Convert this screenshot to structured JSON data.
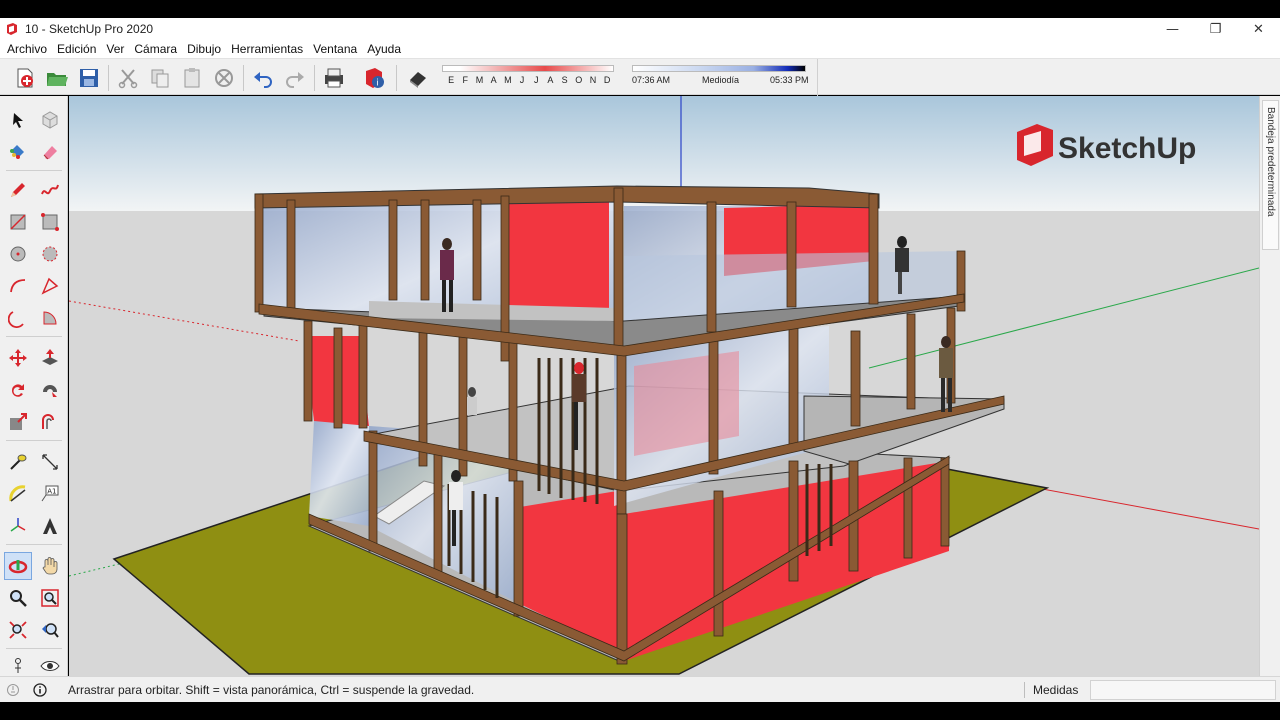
{
  "window": {
    "title": "10 - SketchUp Pro 2020",
    "controls": {
      "minimize": "—",
      "restore": "❐",
      "close": "✕"
    }
  },
  "menu": [
    "Archivo",
    "Edición",
    "Ver",
    "Cámara",
    "Dibujo",
    "Herramientas",
    "Ventana",
    "Ayuda"
  ],
  "toolbar": {
    "icons": [
      "new-file-icon",
      "open-folder-icon",
      "save-icon",
      "cut-icon",
      "copy-icon",
      "paste-icon",
      "erase-icon",
      "undo-icon",
      "redo-icon",
      "print-icon",
      "model-info-icon",
      "shadows-toggle-icon"
    ]
  },
  "shadows": {
    "months": [
      "E",
      "F",
      "M",
      "A",
      "M",
      "J",
      "J",
      "A",
      "S",
      "O",
      "N",
      "D"
    ],
    "time_start": "07:36 AM",
    "time_mid": "Mediodía",
    "time_end": "05:33 PM"
  },
  "viewport": {
    "logo_text": "SketchUp",
    "colors": {
      "sky_top": "#a9c6db",
      "sky_bottom": "#f2f4f5",
      "ground": "#d7d7d7",
      "lawn": "#8f8f12",
      "wall_red": "#f23640",
      "wood": "#8a5a34",
      "slab": "#bdbdbd",
      "glass": "#9fb2d2"
    }
  },
  "tray": {
    "label": "Bandeja predeterminada"
  },
  "status": {
    "hint": "Arrastrar para orbitar. Shift = vista panorámica, Ctrl = suspende la gravedad.",
    "measure_label": "Medidas",
    "measure_value": ""
  }
}
